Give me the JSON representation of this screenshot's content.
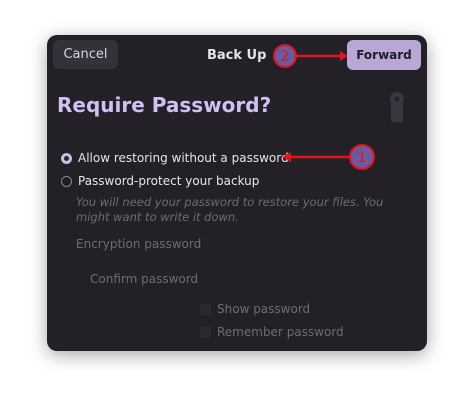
{
  "header": {
    "cancel_label": "Cancel",
    "title": "Back Up",
    "forward_label": "Forward"
  },
  "main": {
    "heading": "Require Password?",
    "options": [
      {
        "label": "Allow restoring without a password",
        "selected": true
      },
      {
        "label": "Password-protect your backup",
        "selected": false
      }
    ],
    "hint": "You will need your password to restore your files. You might want to write it down.",
    "encryption_label": "Encryption password",
    "confirm_label": "Confirm password",
    "show_password_label": "Show password",
    "remember_password_label": "Remember password"
  },
  "annotations": {
    "step1": "1",
    "step2": "2",
    "color": "#e0151b"
  },
  "colors": {
    "dialog_bg": "#242027",
    "accent": "#b9a8d6",
    "heading": "#d2c0f2"
  },
  "icons": [
    "lock-icon",
    "arrow-icon"
  ]
}
